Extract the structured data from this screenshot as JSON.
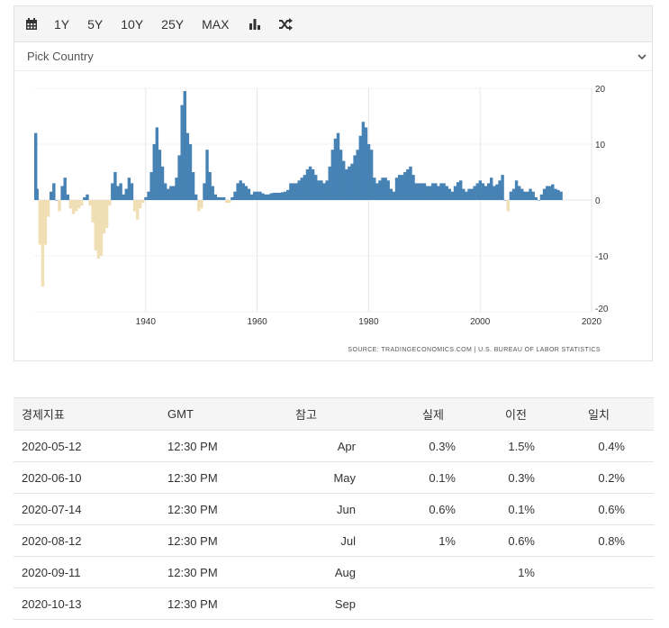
{
  "toolbar": {
    "items": [
      {
        "icon": "calendar-icon"
      },
      {
        "label": "1Y"
      },
      {
        "label": "5Y"
      },
      {
        "label": "10Y"
      },
      {
        "label": "25Y"
      },
      {
        "label": "MAX"
      },
      {
        "icon": "bar-chart-icon"
      },
      {
        "icon": "shuffle-icon"
      }
    ]
  },
  "country_picker": {
    "label": "Pick Country",
    "icon": "chevron-down-icon"
  },
  "colors": {
    "positive": "#4682b4",
    "negative": "#f0deb4",
    "grid": "#e6e6e6"
  },
  "chart_data": {
    "type": "bar",
    "source": "SOURCE: TRADINGECONOMICS.COM | U.S. BUREAU OF LABOR STATISTICS",
    "x_ticks": [
      "1940",
      "1960",
      "1980",
      "2000",
      "2020"
    ],
    "y_ticks": [
      "20",
      "10",
      "0",
      "-10",
      "-20"
    ],
    "xlim": [
      1920,
      2020
    ],
    "ylim": [
      -20,
      20
    ],
    "grid": true,
    "x": [
      1920,
      1920.5,
      1921,
      1921.5,
      1922,
      1922.5,
      1923,
      1923.5,
      1924,
      1924.5,
      1925,
      1925.5,
      1926,
      1926.5,
      1927,
      1927.5,
      1928,
      1928.5,
      1929,
      1929.5,
      1930,
      1930.5,
      1931,
      1931.5,
      1932,
      1932.5,
      1933,
      1933.5,
      1934,
      1934.5,
      1935,
      1935.5,
      1936,
      1936.5,
      1937,
      1937.5,
      1938,
      1938.5,
      1939,
      1939.5,
      1940,
      1940.5,
      1941,
      1941.5,
      1942,
      1942.5,
      1943,
      1943.5,
      1944,
      1944.5,
      1945,
      1945.5,
      1946,
      1946.5,
      1947,
      1947.5,
      1948,
      1948.5,
      1949,
      1949.5,
      1950,
      1950.5,
      1951,
      1951.5,
      1952,
      1952.5,
      1953,
      1953.5,
      1954,
      1954.5,
      1955,
      1955.5,
      1956,
      1956.5,
      1957,
      1957.5,
      1958,
      1958.5,
      1959,
      1959.5,
      1960,
      1960.5,
      1961,
      1961.5,
      1962,
      1962.5,
      1963,
      1963.5,
      1964,
      1964.5,
      1965,
      1965.5,
      1966,
      1966.5,
      1967,
      1967.5,
      1968,
      1968.5,
      1969,
      1969.5,
      1970,
      1970.5,
      1971,
      1971.5,
      1972,
      1972.5,
      1973,
      1973.5,
      1974,
      1974.5,
      1975,
      1975.5,
      1976,
      1976.5,
      1977,
      1977.5,
      1978,
      1978.5,
      1979,
      1979.5,
      1980,
      1980.5,
      1981,
      1981.5,
      1982,
      1982.5,
      1983,
      1983.5,
      1984,
      1984.5,
      1985,
      1985.5,
      1986,
      1986.5,
      1987,
      1987.5,
      1988,
      1988.5,
      1989,
      1989.5,
      1990,
      1990.5,
      1991,
      1991.5,
      1992,
      1992.5,
      1993,
      1993.5,
      1994,
      1994.5,
      1995,
      1995.5,
      1996,
      1996.5,
      1997,
      1997.5,
      1998,
      1998.5,
      1999,
      1999.5,
      2000,
      2000.5,
      2001,
      2001.5,
      2002,
      2002.5,
      2003,
      2003.5,
      2004,
      2004.5,
      2005,
      2005.5,
      2006,
      2006.5,
      2007,
      2007.5,
      2008,
      2008.5,
      2009,
      2009.5,
      2010,
      2010.5,
      2011,
      2011.5,
      2012,
      2012.5,
      2013,
      2013.5,
      2014,
      2014.5,
      2015,
      2015.5,
      2016,
      2016.5,
      2017,
      2017.5,
      2018,
      2018.5,
      2019,
      2019.5,
      2020
    ],
    "values": [
      12,
      2,
      -8,
      -15.5,
      -8,
      -3,
      1.5,
      3,
      0,
      -2,
      2.5,
      4,
      1,
      -1.5,
      -2.5,
      -2,
      -1.5,
      -1,
      0.5,
      1,
      -1,
      -4,
      -9,
      -10.5,
      -10,
      -6,
      -5,
      -1,
      3,
      5,
      2.5,
      3,
      1,
      2,
      4,
      3,
      -2,
      -3.5,
      -1.5,
      -0.5,
      0.5,
      1.5,
      5,
      10,
      13,
      9,
      6,
      3,
      2,
      2.5,
      2.5,
      4,
      8,
      17,
      19.5,
      12,
      10,
      5,
      1,
      -2,
      -1.5,
      3,
      9,
      5,
      2.5,
      1,
      0.5,
      0.5,
      0.5,
      -0.5,
      -0.5,
      0.5,
      1.5,
      3,
      3.5,
      3,
      2.5,
      2,
      1,
      1.5,
      1.5,
      1.5,
      1.2,
      1,
      1,
      1.2,
      1.3,
      1.3,
      1.3,
      1.4,
      1.5,
      1.8,
      3,
      3,
      3,
      3.5,
      4,
      4.5,
      5.5,
      6,
      5.5,
      4.5,
      3.5,
      3.5,
      3,
      3.5,
      6,
      9,
      11,
      12,
      9,
      7,
      5.5,
      6,
      6.5,
      8,
      9,
      11.5,
      14,
      13,
      10,
      9,
      4,
      3,
      3.5,
      4,
      4,
      3.5,
      2,
      1.5,
      4,
      4.5,
      4.5,
      5,
      5.5,
      6,
      4.5,
      3,
      3,
      3,
      3,
      2.5,
      2.5,
      3,
      3,
      2.5,
      3,
      3,
      2.5,
      2,
      1.5,
      2.5,
      3.2,
      3.5,
      2,
      1.5,
      2,
      2,
      2.5,
      3,
      3.5,
      3,
      2.5,
      3,
      4,
      2.5,
      2.8,
      3.5,
      4.5,
      0,
      -2,
      1.5,
      2,
      3.5,
      2.5,
      2,
      1.5,
      1.5,
      2,
      1.5,
      0.5,
      0,
      1,
      2,
      2.5,
      2.5,
      2.8,
      2,
      1.8,
      1.5
    ]
  },
  "table": {
    "headers": [
      "경제지표",
      "GMT",
      "참고",
      "실제",
      "이전",
      "일치"
    ],
    "rows": [
      {
        "date": "2020-05-12",
        "time": "12:30 PM",
        "ref": "Apr",
        "actual": "0.3%",
        "previous": "1.5%",
        "consensus": "0.4%"
      },
      {
        "date": "2020-06-10",
        "time": "12:30 PM",
        "ref": "May",
        "actual": "0.1%",
        "previous": "0.3%",
        "consensus": "0.2%"
      },
      {
        "date": "2020-07-14",
        "time": "12:30 PM",
        "ref": "Jun",
        "actual": "0.6%",
        "previous": "0.1%",
        "consensus": "0.6%"
      },
      {
        "date": "2020-08-12",
        "time": "12:30 PM",
        "ref": "Jul",
        "actual": "1%",
        "previous": "0.6%",
        "consensus": "0.8%"
      },
      {
        "date": "2020-09-11",
        "time": "12:30 PM",
        "ref": "Aug",
        "actual": "",
        "previous": "1%",
        "consensus": ""
      },
      {
        "date": "2020-10-13",
        "time": "12:30 PM",
        "ref": "Sep",
        "actual": "",
        "previous": "",
        "consensus": ""
      }
    ]
  }
}
